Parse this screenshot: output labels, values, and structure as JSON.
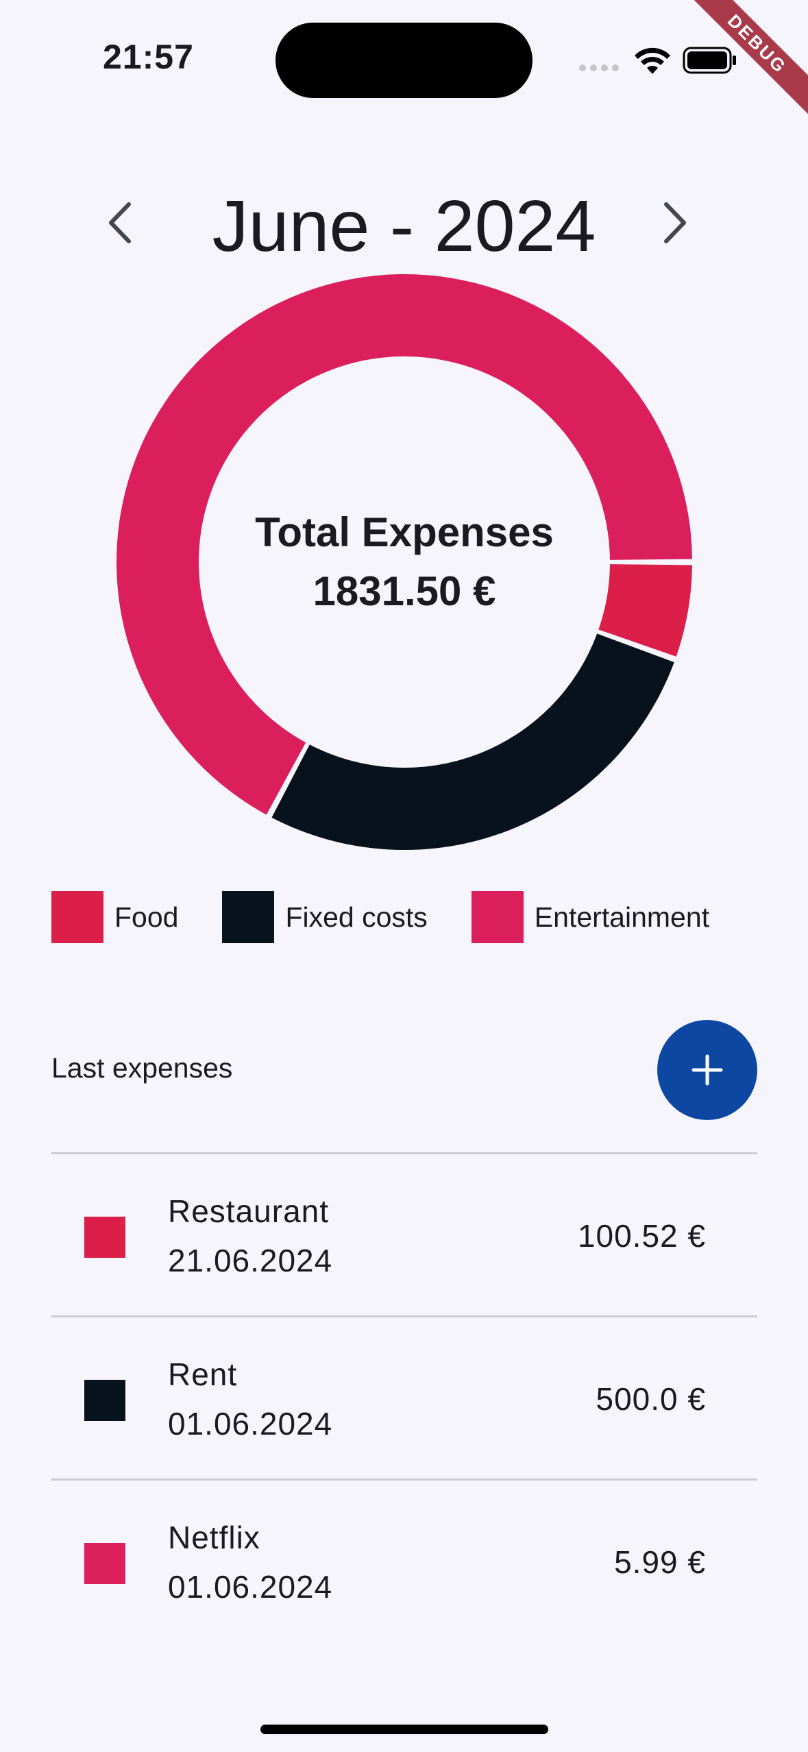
{
  "status_bar": {
    "time": "21:57"
  },
  "debug_banner": "DEBUG",
  "month_nav": {
    "title": "June - 2024",
    "prev_icon": "chevron-left-icon",
    "next_icon": "chevron-right-icon"
  },
  "chart": {
    "center_title": "Total Expenses",
    "center_total": "1831.50 €"
  },
  "chart_data": {
    "type": "pie",
    "categories": [
      "Food",
      "Fixed costs",
      "Entertainment"
    ],
    "values": [
      100.52,
      500.0,
      1230.98
    ],
    "colors": [
      "#DC1F49",
      "#08121C",
      "#DB1F5D"
    ],
    "start": "3 o'clock, clockwise",
    "title": "",
    "legend_position": "bottom"
  },
  "legend": [
    {
      "label": "Food",
      "color": "#DC1F49"
    },
    {
      "label": "Fixed costs",
      "color": "#08121C"
    },
    {
      "label": "Entertainment",
      "color": "#DB1F5D"
    }
  ],
  "last_expenses": {
    "title": "Last expenses",
    "add_icon": "plus-icon",
    "items": [
      {
        "name": "Restaurant",
        "date": "21.06.2024",
        "amount": "100.52 €",
        "color": "#DC1F49"
      },
      {
        "name": "Rent",
        "date": "01.06.2024",
        "amount": "500.0 €",
        "color": "#08121C"
      },
      {
        "name": "Netflix",
        "date": "01.06.2024",
        "amount": "5.99 €",
        "color": "#DB1F5D"
      }
    ]
  },
  "colors": {
    "background": "#F7F5FC",
    "accent": "#0D47A1",
    "divider": "#CBC9D1"
  }
}
